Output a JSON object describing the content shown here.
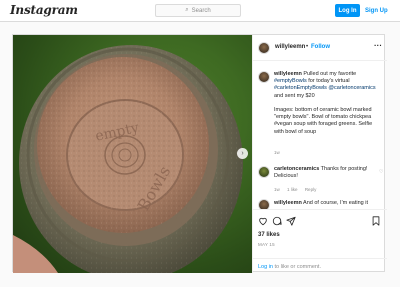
{
  "nav": {
    "logo": "Instagram",
    "search_placeholder": "Search",
    "login_label": "Log In",
    "signup_label": "Sign Up"
  },
  "post": {
    "username": "willyleemn",
    "dot": "•",
    "follow_label": "Follow",
    "caption": {
      "user": "willyleemn",
      "line1": " Pulled out my favorite",
      "tag1": "#emptyBowls",
      "line2": " for today's virtual",
      "tag2": "#carletonEmptyBowls",
      "mention": "@carletonceramics",
      "line3": " and sent my $20",
      "body": "Images: bottom of ceramic bowl marked \"empty bowls\". Bowl of tomato chickpea #vegan soup with foraged greens. Selfie with bowl of soup",
      "time": "1w"
    },
    "comment1": {
      "user": "carletonceramics",
      "text": " Thanks for posting! Delicious!",
      "time": "1w",
      "likes": "1 like",
      "reply": "Reply"
    },
    "comment2": {
      "user": "willyleemn",
      "text": " And of course, I'm eating it"
    },
    "likes": "37 likes",
    "date": "MAY 15",
    "login_prompt": {
      "link": "Log in",
      "rest": " to like or comment."
    }
  },
  "icons": {
    "search": "magnifier",
    "more": "ellipsis",
    "like": "heart",
    "comment": "speech-bubble",
    "share": "paper-plane",
    "save": "bookmark",
    "next": "chevron-right"
  },
  "colors": {
    "accent": "#0095f6",
    "link_dark": "#00376b",
    "muted": "#8e8e8e",
    "border": "#dbdbdb"
  }
}
